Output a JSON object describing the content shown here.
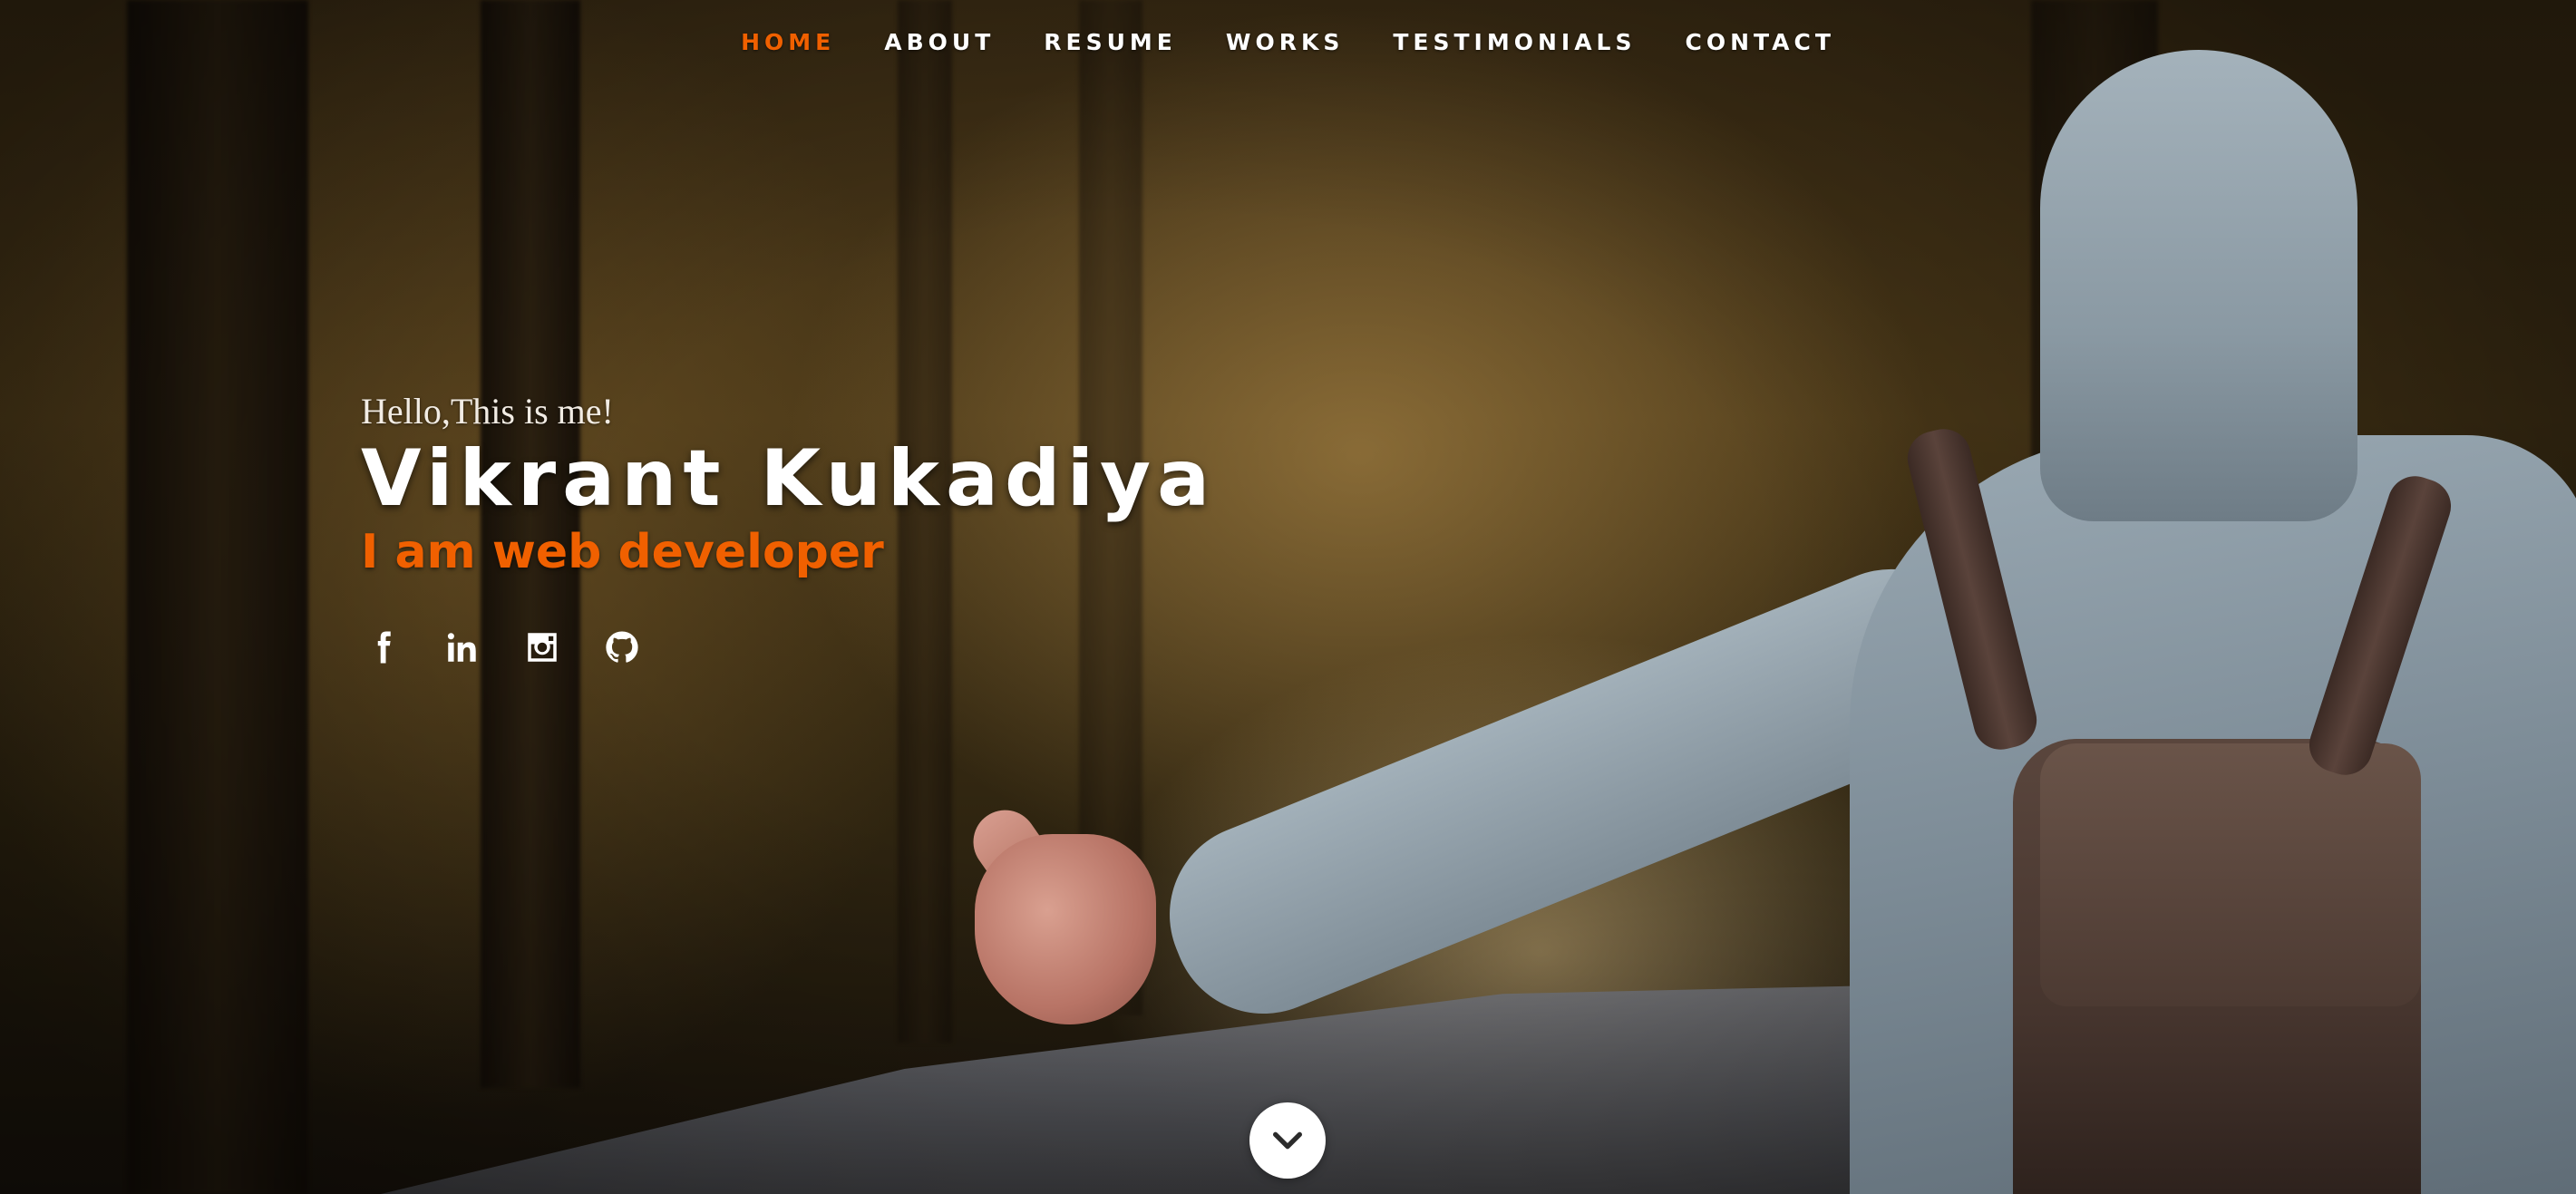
{
  "nav": {
    "items": [
      {
        "label": "HOME",
        "active": true
      },
      {
        "label": "ABOUT",
        "active": false
      },
      {
        "label": "RESUME",
        "active": false
      },
      {
        "label": "WORKS",
        "active": false
      },
      {
        "label": "TESTIMONIALS",
        "active": false
      },
      {
        "label": "CONTACT",
        "active": false
      }
    ],
    "active_color": "#f06000"
  },
  "intro": {
    "greeting": "Hello,This is me!",
    "name": "Vikrant Kukadiya",
    "role": "I am web developer"
  },
  "social": {
    "icons": [
      "facebook-icon",
      "linkedin-icon",
      "instagram-icon",
      "github-icon"
    ]
  },
  "scroll_down": {
    "icon": "chevron-down-icon"
  },
  "colors": {
    "accent": "#f06000",
    "text": "#ffffff"
  }
}
